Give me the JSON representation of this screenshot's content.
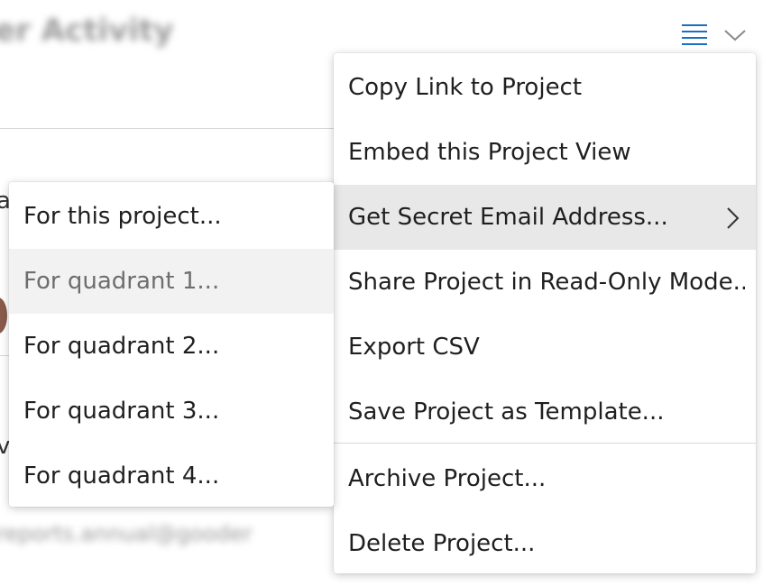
{
  "background": {
    "title": "er Activity",
    "peek_1": "a",
    "peek_2": "v",
    "email": "reports.annual@gooder"
  },
  "header": {
    "menu_icon": "hamburger-icon",
    "chevron_icon": "chevron-down-icon",
    "accent_color": "#1a6fc4"
  },
  "main_menu": {
    "items": [
      {
        "label": "Copy Link to Project"
      },
      {
        "label": "Embed this Project View"
      },
      {
        "label": "Get Secret Email Address...",
        "has_submenu": true
      },
      {
        "label": "Share Project in Read-Only Mode..."
      },
      {
        "label": "Export CSV"
      },
      {
        "label": "Save Project as Template..."
      },
      {
        "label": "Archive Project..."
      },
      {
        "label": "Delete Project..."
      }
    ]
  },
  "sub_menu": {
    "items": [
      {
        "label": "For this project..."
      },
      {
        "label": "For quadrant 1..."
      },
      {
        "label": "For quadrant 2..."
      },
      {
        "label": "For quadrant 3..."
      },
      {
        "label": "For quadrant 4..."
      }
    ]
  }
}
